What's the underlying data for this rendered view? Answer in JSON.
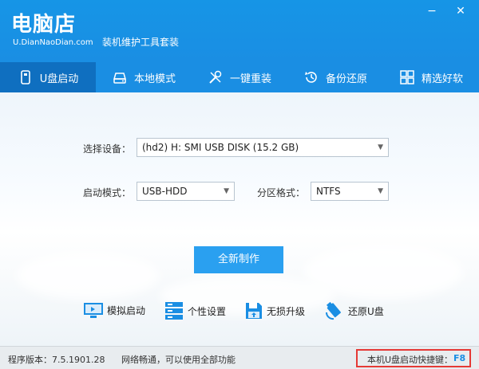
{
  "app": {
    "logo_title": "电脑店",
    "logo_sub": "U.DianNaoDian.com",
    "tagline": "装机维护工具套装"
  },
  "window_controls": {
    "minimize": "−",
    "close": "✕"
  },
  "tabs": [
    {
      "label": "U盘启动",
      "icon": "usb-icon",
      "active": true
    },
    {
      "label": "本地模式",
      "icon": "hard-drive-icon",
      "active": false
    },
    {
      "label": "一键重装",
      "icon": "tools-icon",
      "active": false
    },
    {
      "label": "备份还原",
      "icon": "restore-icon",
      "active": false
    },
    {
      "label": "精选好软",
      "icon": "grid-icon",
      "active": false
    }
  ],
  "form": {
    "device_label": "选择设备：",
    "device_value": "(hd2) H: SMI USB DISK (15.2 GB)",
    "boot_mode_label": "启动模式：",
    "boot_mode_value": "USB-HDD",
    "partition_label": "分区格式：",
    "partition_value": "NTFS",
    "make_button": "全新制作"
  },
  "tools": [
    {
      "label": "模拟启动",
      "icon": "monitor-icon"
    },
    {
      "label": "个性设置",
      "icon": "server-icon"
    },
    {
      "label": "无损升级",
      "icon": "floppy-upgrade-icon"
    },
    {
      "label": "还原U盘",
      "icon": "usb-restore-icon"
    }
  ],
  "status": {
    "version": "程序版本：7.5.1901.28",
    "network": "网络畅通，可以使用全部功能",
    "hotkey_label": "本机U盘启动快捷键：",
    "hotkey_value": "F8"
  },
  "colors": {
    "header": "#1a8ee3",
    "active_tab": "#0f6fc0",
    "button": "#2aa0f0",
    "hotkey_border": "#e53935"
  }
}
